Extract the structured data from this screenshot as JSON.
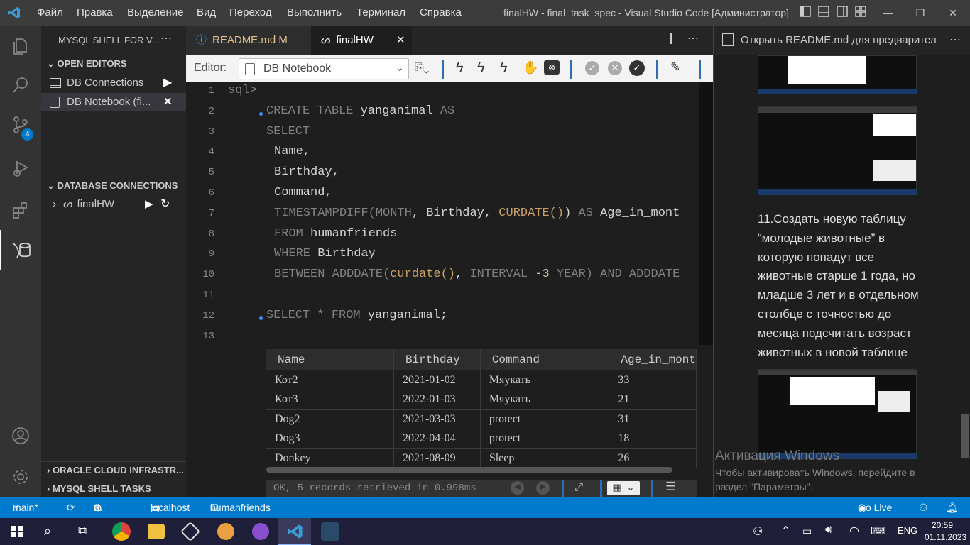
{
  "titlebar": {
    "menu": [
      "Файл",
      "Правка",
      "Выделение",
      "Вид",
      "Переход",
      "Выполнить",
      "Терминал",
      "Справка"
    ],
    "window_title": "finalHW - final_task_spec - Visual Studio Code [Администратор]"
  },
  "sidebar": {
    "header": "MYSQL SHELL FOR V...",
    "open_editors": "OPEN EDITORS",
    "editors": [
      "DB Connections",
      "DB Notebook (fi..."
    ],
    "db_connections": "DATABASE CONNECTIONS",
    "connection": "finalHW",
    "oracle": "ORACLE CLOUD INFRASTR...",
    "tasks": "MYSQL SHELL TASKS",
    "badge": "4"
  },
  "tabs": [
    {
      "label": "README.md",
      "flag": "M"
    },
    {
      "label": "finalHW"
    }
  ],
  "toolbar": {
    "editor_label": "Editor:",
    "editor_select": "DB Notebook"
  },
  "editor": {
    "lines": [
      {
        "n": "1",
        "indent": 0,
        "parts": [
          [
            "kw2",
            "sql>"
          ]
        ]
      },
      {
        "n": "2",
        "indent": 1,
        "bullet": true,
        "parts": [
          [
            "kw",
            "CREATE TABLE "
          ],
          [
            "id",
            "yanganimal "
          ],
          [
            "kw",
            "AS"
          ]
        ]
      },
      {
        "n": "3",
        "indent": 1,
        "parts": [
          [
            "kw",
            "SELECT"
          ]
        ]
      },
      {
        "n": "4",
        "indent": 2,
        "parts": [
          [
            "id",
            "Name,"
          ]
        ]
      },
      {
        "n": "5",
        "indent": 2,
        "parts": [
          [
            "id",
            "Birthday,"
          ]
        ]
      },
      {
        "n": "6",
        "indent": 2,
        "parts": [
          [
            "id",
            "Command,"
          ]
        ]
      },
      {
        "n": "7",
        "indent": 2,
        "parts": [
          [
            "kw",
            "TIMESTAMPDIFF("
          ],
          [
            "kw",
            "MONTH"
          ],
          [
            "id",
            ", Birthday, "
          ],
          [
            "fn",
            "CURDATE()"
          ],
          [
            "id",
            ") "
          ],
          [
            "kw",
            "AS "
          ],
          [
            "id",
            "Age_in_mont"
          ]
        ]
      },
      {
        "n": "8",
        "indent": 2,
        "parts": [
          [
            "kw",
            "FROM "
          ],
          [
            "id",
            "humanfriends"
          ]
        ]
      },
      {
        "n": "9",
        "indent": 2,
        "parts": [
          [
            "kw",
            "WHERE "
          ],
          [
            "id",
            "Birthday"
          ]
        ]
      },
      {
        "n": "10",
        "indent": 2,
        "parts": [
          [
            "kw",
            "BETWEEN ADDDATE("
          ],
          [
            "fn",
            "curdate()"
          ],
          [
            "id",
            ", "
          ],
          [
            "kw",
            "INTERVAL "
          ],
          [
            "num",
            "-3 "
          ],
          [
            "kw",
            "YEAR) AND ADDDATE"
          ]
        ]
      },
      {
        "n": "11",
        "indent": 2,
        "parts": []
      },
      {
        "n": "12",
        "indent": 1,
        "bullet": true,
        "parts": [
          [
            "kw",
            "SELECT * FROM "
          ],
          [
            "id",
            "yanganimal;"
          ]
        ]
      },
      {
        "n": "13",
        "indent": 0,
        "parts": []
      }
    ]
  },
  "results": {
    "columns": [
      "Name",
      "Birthday",
      "Command",
      "Age_in_mont"
    ],
    "rows": [
      [
        "Кот2",
        "2021-01-02",
        "Мяукать",
        "33"
      ],
      [
        "Кот3",
        "2022-01-03",
        "Мяукать",
        "21"
      ],
      [
        "Dog2",
        "2021-03-03",
        "protect",
        "31"
      ],
      [
        "Dog3",
        "2022-04-04",
        "protect",
        "18"
      ],
      [
        "Donkey",
        "2021-08-09",
        "Sleep",
        "26"
      ]
    ],
    "status": "OK, 5 records retrieved in 0.998ms"
  },
  "right_panel": {
    "tab": "Открыть README.md для предварител",
    "text_lines": [
      "11.Создать новую таблицу",
      "“молодые животные” в",
      "которую попадут все",
      "животные старше 1 года, но",
      "младше 3 лет и в отдельном",
      "столбце с точностью до",
      "месяца подсчитать возраст",
      "животных в новой таблице"
    ],
    "watermark_title": "Активация Windows",
    "watermark_text": "Чтобы активировать Windows, перейдите в раздел \"Параметры\"."
  },
  "statusbar": {
    "branch": "main*",
    "errors": "0",
    "warnings": "0",
    "host": "localhost",
    "schema": "humanfriends",
    "golive": "Go Live"
  },
  "taskbar": {
    "time": "20:59",
    "date": "01.11.2023",
    "lang": "ENG"
  }
}
